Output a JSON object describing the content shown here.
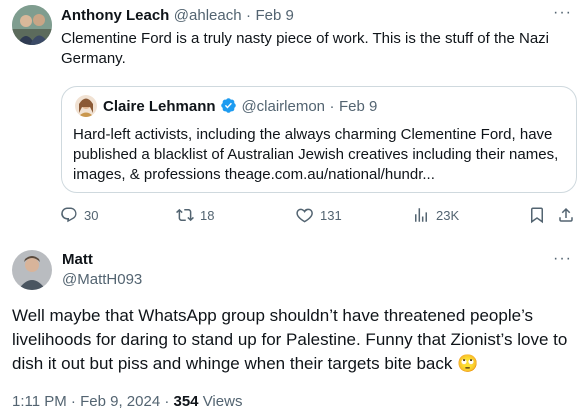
{
  "tweet": {
    "author_name": "Anthony Leach",
    "handle": "@ahleach",
    "separator": "·",
    "date": "Feb 9",
    "text": "Clementine Ford is a truly nasty piece of work. This is the stuff of the Nazi Germany.",
    "more": "···",
    "quote": {
      "author_name": "Claire Lehmann",
      "handle": "@clairlemon",
      "date": "Feb 9",
      "verified": true,
      "text": "Hard-left activists, including the always charming Clementine Ford, have published a blacklist of Australian Jewish creatives including their names, images, & professions theage.com.au/national/hundr..."
    },
    "actions": {
      "replies": "30",
      "reposts": "18",
      "likes": "131",
      "views": "23K"
    }
  },
  "reply": {
    "author_name": "Matt",
    "handle": "@MattH093",
    "more": "···",
    "text": "Well maybe that WhatsApp group shouldn’t have threatened people’s livelihoods for daring to stand up for Palestine. Funny that Zionist’s love to dish it out but piss and whinge when their targets bite back",
    "emoji": "🙄",
    "time": "1:11 PM",
    "date": "Feb 9, 2024",
    "separator": "·",
    "views_count": "354",
    "views_label": "Views"
  },
  "colors": {
    "accent": "#1d9bf0",
    "muted": "#536471",
    "border": "#cfd9de"
  },
  "icons": [
    "reply-icon",
    "repost-icon",
    "like-icon",
    "views-icon",
    "bookmark-icon",
    "share-icon",
    "verified-badge-icon",
    "more-icon"
  ]
}
